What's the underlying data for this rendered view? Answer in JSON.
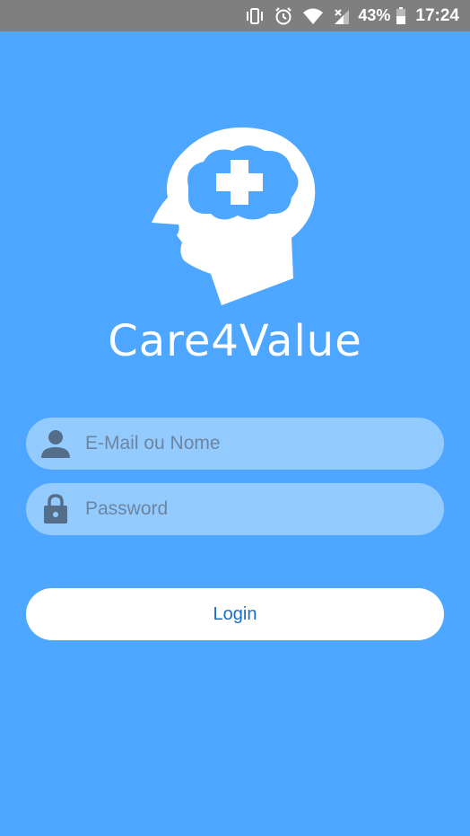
{
  "status_bar": {
    "battery_percent": "43%",
    "time": "17:24",
    "icons": [
      "vibrate-icon",
      "alarm-icon",
      "wifi-icon",
      "signal-icon",
      "battery-icon"
    ]
  },
  "app": {
    "name": "Care4Value",
    "logo_icon": "head-medical-cross-icon"
  },
  "login_form": {
    "email_placeholder": "E-Mail ou Nome",
    "email_value": "",
    "password_placeholder": "Password",
    "password_value": "",
    "login_label": "Login"
  },
  "colors": {
    "background": "#4da6ff",
    "field_background": "#94cbff",
    "button_background": "#ffffff",
    "button_text": "#1a6fc6",
    "status_bar": "#7f7f7f"
  }
}
